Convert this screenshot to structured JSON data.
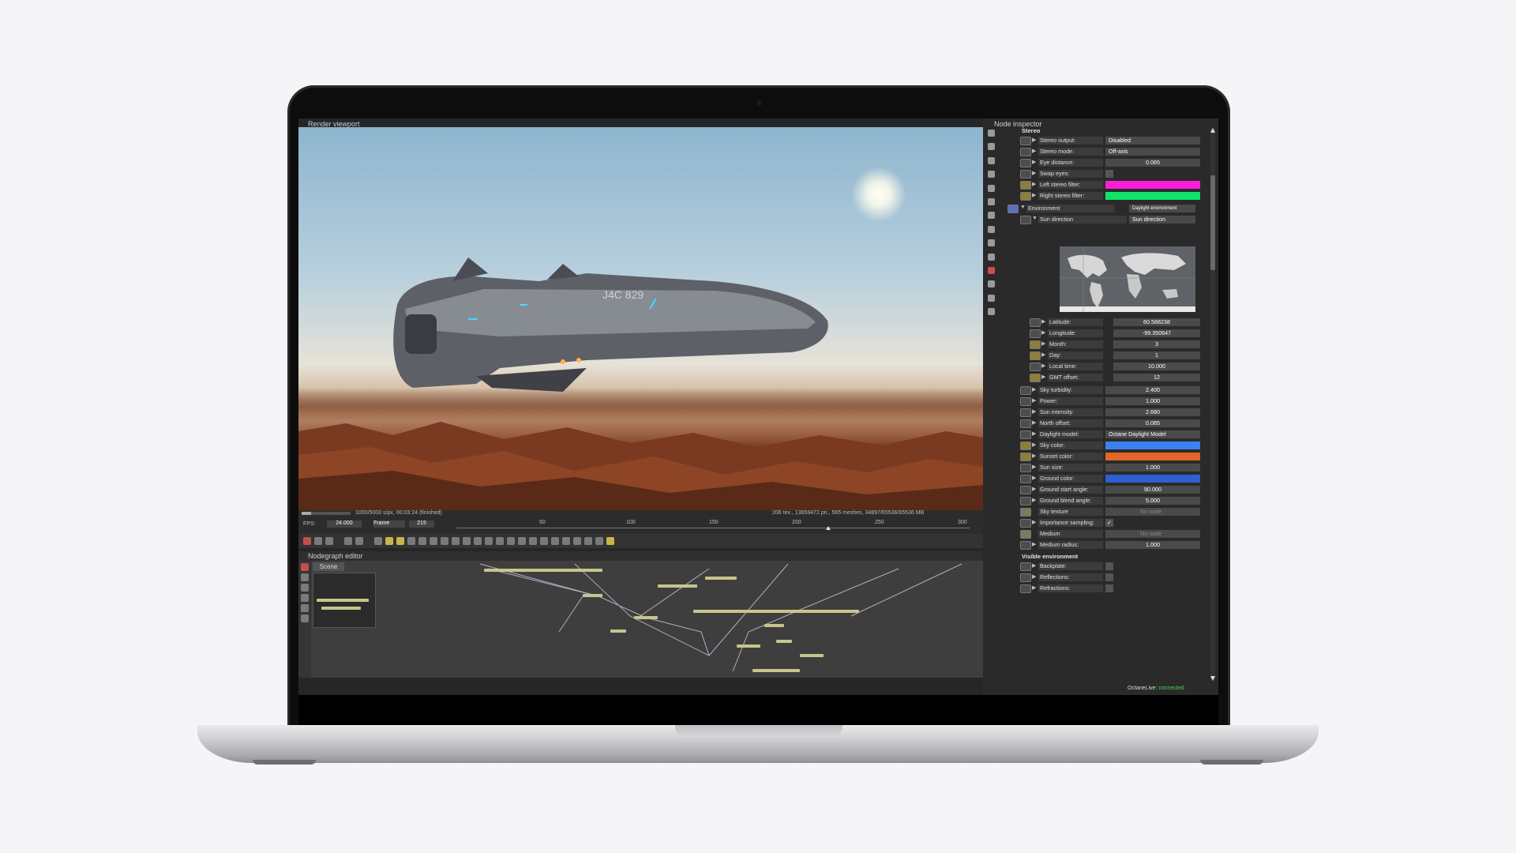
{
  "viewport": {
    "title": "Render viewport",
    "progress_text": "1000/5000 s/px, 00:03:24 (finished)",
    "stats_text": "206 tex., 13659472 pri., 565 meshes, 34897/65536/65536 MB",
    "fps_label": "FPS:",
    "fps_value": "24.000",
    "frame_label": "Frame",
    "frame_value": "215",
    "ruler_ticks": [
      "50",
      "100",
      "150",
      "200",
      "250",
      "300"
    ],
    "render_progress": 0.2,
    "timeline_position": 0.72
  },
  "nodegraph": {
    "title": "Nodegraph editor",
    "tab": "Scene"
  },
  "inspector": {
    "title": "Node inspector",
    "sections": {
      "stereo": "Stereo",
      "environment": "Environment",
      "environment_value": "Daylight environment",
      "visible_env": "Visible environment"
    },
    "stereo_rows": [
      {
        "label": "Stereo output:",
        "value": "Disabled"
      },
      {
        "label": "Stereo mode:",
        "value": "Off-axis"
      },
      {
        "label": "Eye distance:",
        "value": "0.065"
      },
      {
        "label": "Swap eyes:",
        "value": ""
      },
      {
        "label": "Left stereo filter:",
        "value": ""
      },
      {
        "label": "Right stereo filter:",
        "value": ""
      }
    ],
    "sun_direction": {
      "label": "Sun direction",
      "value": "Sun direction"
    },
    "sun_rows": [
      {
        "label": "Latitude:",
        "value": "60.588238"
      },
      {
        "label": "Longitude:",
        "value": "-99.350647"
      },
      {
        "label": "Month:",
        "value": "3"
      },
      {
        "label": "Day:",
        "value": "1"
      },
      {
        "label": "Local time:",
        "value": "10.000"
      },
      {
        "label": "GMT offset:",
        "value": "12"
      }
    ],
    "env_rows": [
      {
        "label": "Sky turbidity:",
        "value": "2.400"
      },
      {
        "label": "Power:",
        "value": "1.000"
      },
      {
        "label": "Sun intensity:",
        "value": "2.680"
      },
      {
        "label": "North offset:",
        "value": "0.085"
      },
      {
        "label": "Daylight model:",
        "value": "Octane Daylight Model"
      },
      {
        "label": "Sky color:",
        "value": ""
      },
      {
        "label": "Sunset color:",
        "value": ""
      },
      {
        "label": "Sun size:",
        "value": "1.000"
      },
      {
        "label": "Ground color:",
        "value": ""
      },
      {
        "label": "Ground start angle:",
        "value": "90.000"
      },
      {
        "label": "Ground blend angle:",
        "value": "5.000"
      },
      {
        "label": "Sky texture",
        "value": "No node"
      },
      {
        "label": "Importance sampling:",
        "value": "✓"
      },
      {
        "label": "Medium",
        "value": "No node"
      },
      {
        "label": "Medium radius:",
        "value": "1.000"
      }
    ],
    "visible_rows": [
      {
        "label": "Backplate:",
        "value": ""
      },
      {
        "label": "Reflections:",
        "value": ""
      },
      {
        "label": "Refractions:",
        "value": ""
      }
    ],
    "colors": {
      "left_stereo": "#ff1ed8",
      "right_stereo": "#10e36a",
      "sky": "#3b82f0",
      "sunset": "#e2662a",
      "ground": "#2f5fd6"
    }
  },
  "status": {
    "label": "OctaneLive:",
    "value": "connected"
  },
  "ship_registration": "J4C 829"
}
